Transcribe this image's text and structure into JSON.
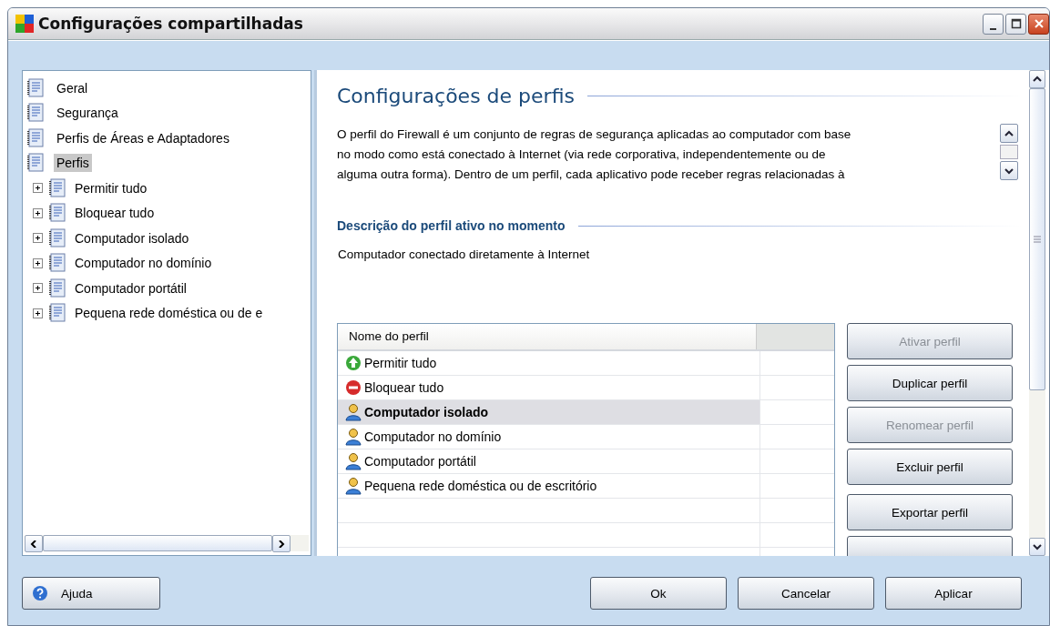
{
  "window": {
    "title": "Configurações compartilhadas"
  },
  "tree": [
    {
      "label": "Geral",
      "selected": false
    },
    {
      "label": "Segurança",
      "selected": false
    },
    {
      "label": "Perfis de Áreas e Adaptadores",
      "selected": false
    },
    {
      "label": "Perfis",
      "selected": true,
      "children": [
        {
          "label": "Permitir tudo",
          "selected": false,
          "expanded": false
        },
        {
          "label": "Bloquear tudo",
          "selected": false,
          "expanded": false
        },
        {
          "label": "Computador isolado",
          "selected": false,
          "expanded": false
        },
        {
          "label": "Computador no domínio",
          "selected": false,
          "expanded": false
        },
        {
          "label": "Computador portátil",
          "selected": false,
          "expanded": false
        },
        {
          "label": "Pequena rede doméstica ou de e",
          "selected": false,
          "expanded": false
        }
      ]
    }
  ],
  "content": {
    "title": "Configurações de perfis",
    "description": [
      "O perfil do Firewall é um conjunto de regras de segurança aplicadas ao computador com base",
      "no modo como está conectado à Internet (via rede corporativa, independentemente ou de",
      "alguma outra forma). Dentro de um perfil, cada aplicativo pode receber regras relacionadas à"
    ],
    "active_section_title": "Descrição do perfil ativo no momento",
    "active_description": "Computador conectado diretamente à Internet"
  },
  "table": {
    "columns": [
      "Nome do perfil"
    ],
    "rows": [
      {
        "kind": "allow",
        "name": "Permitir tudo",
        "selected": false,
        "active": false
      },
      {
        "kind": "block",
        "name": "Bloquear tudo",
        "selected": false,
        "active": false
      },
      {
        "kind": "user",
        "name": "Computador isolado",
        "selected": true,
        "active": true
      },
      {
        "kind": "user",
        "name": "Computador no domínio",
        "selected": false,
        "active": false
      },
      {
        "kind": "user",
        "name": "Computador portátil",
        "selected": false,
        "active": false
      },
      {
        "kind": "user",
        "name": "Pequena rede doméstica ou de escritório",
        "selected": false,
        "active": false
      }
    ]
  },
  "profile_buttons": [
    {
      "label": "Ativar perfil",
      "disabled": true
    },
    {
      "label": "Duplicar perfil",
      "disabled": false
    },
    {
      "label": "Renomear perfil",
      "disabled": true
    },
    {
      "label": "Excluir perfil",
      "disabled": false
    },
    {
      "label": "Exportar perfil",
      "disabled": false
    }
  ],
  "help_button": "Ajuda",
  "buttons": [
    "Ok",
    "Cancelar",
    "Aplicar"
  ]
}
